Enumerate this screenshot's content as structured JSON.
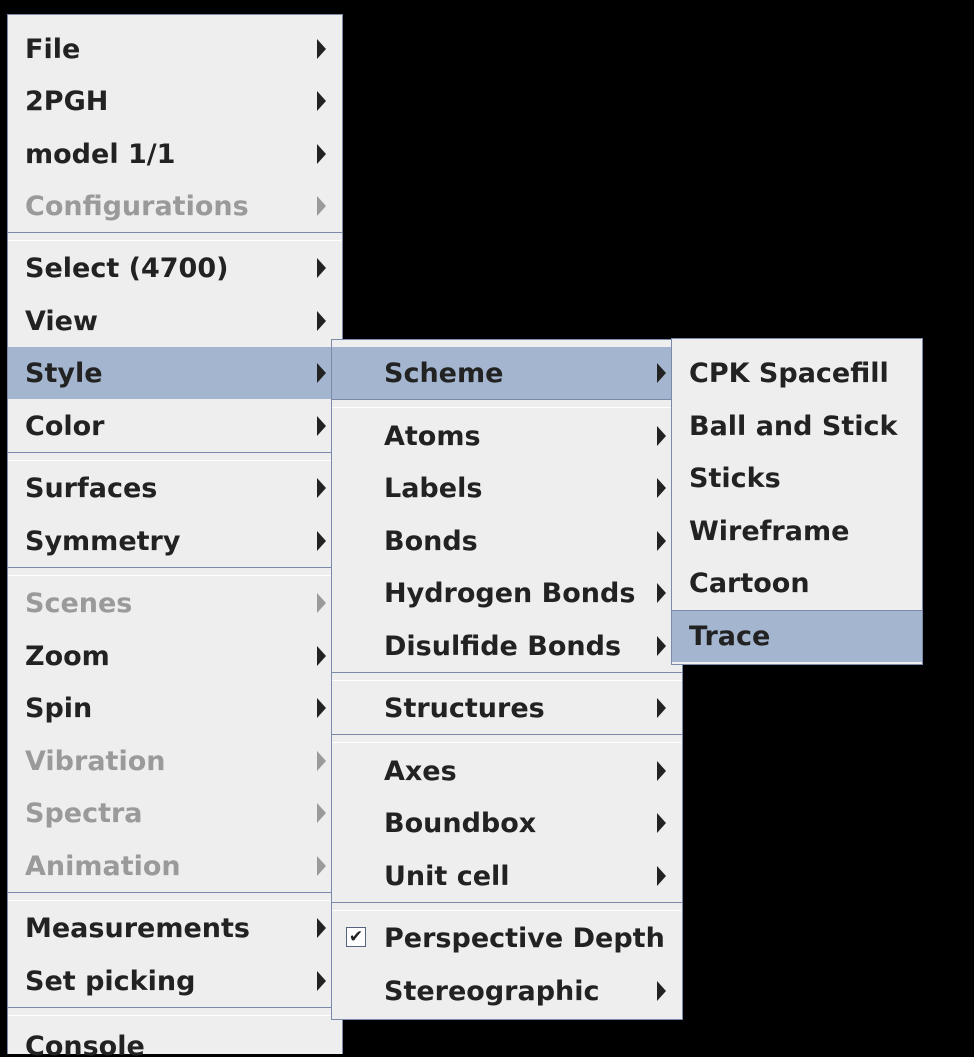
{
  "main_menu": {
    "file": "File",
    "pdb": "2PGH",
    "model": "model 1/1",
    "configurations": "Configurations",
    "select": "Select (4700)",
    "view": "View",
    "style": "Style",
    "color": "Color",
    "surfaces": "Surfaces",
    "symmetry": "Symmetry",
    "scenes": "Scenes",
    "zoom": "Zoom",
    "spin": "Spin",
    "vibration": "Vibration",
    "spectra": "Spectra",
    "animation": "Animation",
    "measurements": "Measurements",
    "set_picking": "Set picking",
    "console": "Console"
  },
  "style_menu": {
    "scheme": "Scheme",
    "atoms": "Atoms",
    "labels": "Labels",
    "bonds": "Bonds",
    "hydrogen_bonds": "Hydrogen Bonds",
    "disulfide_bonds": "Disulfide Bonds",
    "structures": "Structures",
    "axes": "Axes",
    "boundbox": "Boundbox",
    "unit_cell": "Unit cell",
    "perspective_depth": "Perspective Depth",
    "perspective_checked": true,
    "stereographic": "Stereographic"
  },
  "scheme_menu": {
    "cpk": "CPK Spacefill",
    "ball_stick": "Ball and Stick",
    "sticks": "Sticks",
    "wireframe": "Wireframe",
    "cartoon": "Cartoon",
    "trace": "Trace"
  },
  "colors": {
    "menu_bg": "#eeeeee",
    "selected_bg": "#a4b6cf",
    "border": "#7a8aa8",
    "text": "#222222",
    "disabled_text": "#9a9a9a",
    "background": "#000000"
  },
  "icons": {
    "submenu": "triangle-right-icon",
    "checkbox": "checkbox-checked-icon"
  }
}
